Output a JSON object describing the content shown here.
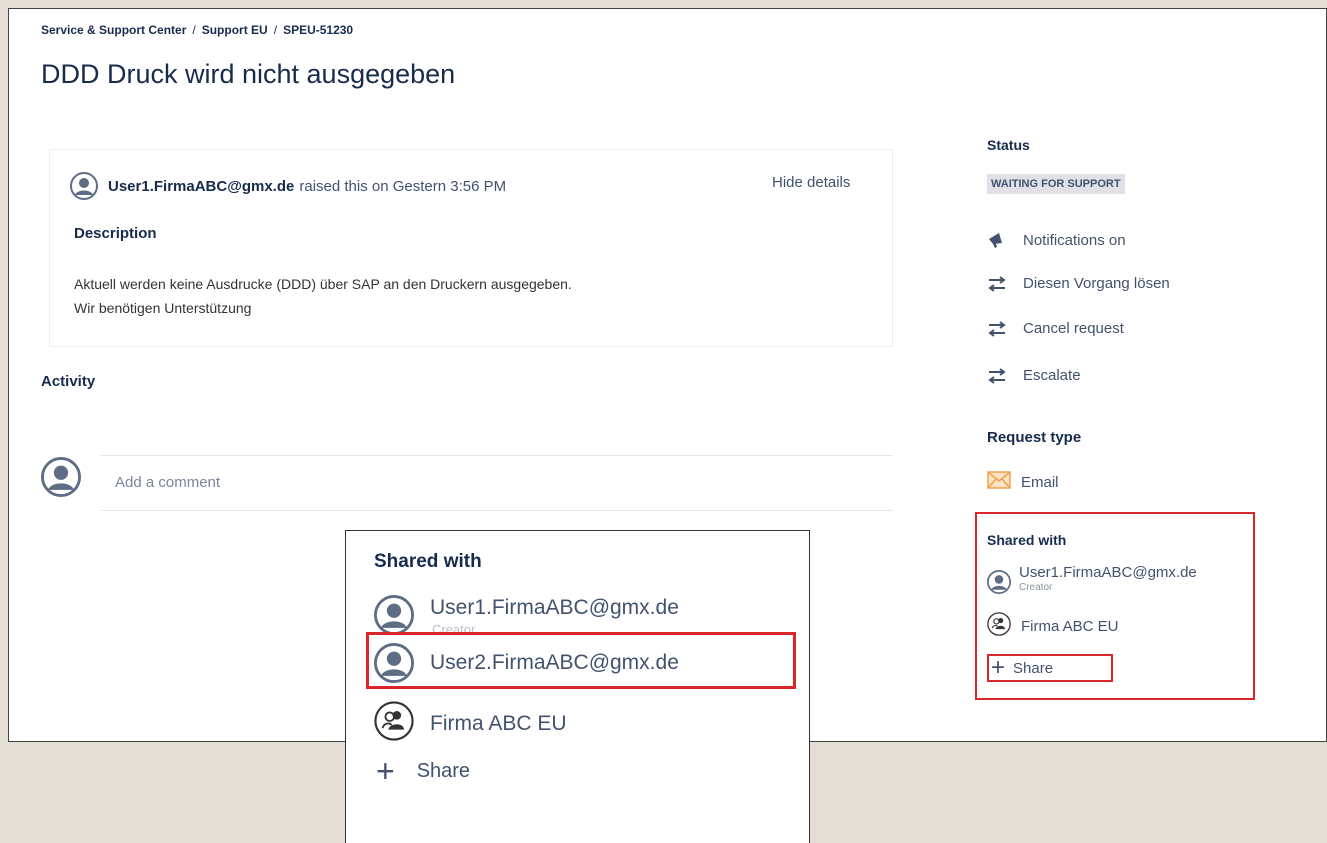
{
  "breadcrumb": {
    "items": [
      "Service & Support Center",
      "Support EU",
      "SPEU-51230"
    ],
    "separator": "/"
  },
  "page_title": "DDD Druck wird nicht ausgegeben",
  "request": {
    "user": "User1.FirmaABC@gmx.de",
    "raised_text": "raised this on Gestern 3:56 PM",
    "hide_details": "Hide details",
    "description_heading": "Description",
    "description_lines": [
      "Aktuell werden keine Ausdrucke (DDD) über SAP an den Druckern ausgegeben.",
      "Wir benötigen Unterstützung"
    ]
  },
  "activity": {
    "heading": "Activity",
    "comment_placeholder": "Add a comment"
  },
  "sidebar": {
    "status_label": "Status",
    "status_value": "WAITING FOR SUPPORT",
    "actions": [
      {
        "label": "Notifications on",
        "icon": "megaphone-icon"
      },
      {
        "label": "Diesen Vorgang lösen",
        "icon": "transition-icon"
      },
      {
        "label": "Cancel request",
        "icon": "transition-icon"
      },
      {
        "label": "Escalate",
        "icon": "transition-icon"
      }
    ],
    "request_type_label": "Request type",
    "request_type_value": "Email",
    "shared_with": {
      "title": "Shared with",
      "user": "User1.FirmaABC@gmx.de",
      "user_role": "Creator",
      "organization": "Firma ABC EU",
      "share_label": "Share"
    }
  },
  "popup": {
    "title": "Shared with",
    "users": [
      {
        "name": "User1.FirmaABC@gmx.de",
        "role": "Creator"
      },
      {
        "name": "User2.FirmaABC@gmx.de",
        "role": ""
      }
    ],
    "organization": "Firma ABC EU",
    "share_label": "Share"
  },
  "colors": {
    "highlight": "#d9262b",
    "text": "#172b4d",
    "muted": "#42526e",
    "background": "#e3ded6",
    "lozenge": "#dfe1e6",
    "email_icon": "#f0a04b"
  }
}
